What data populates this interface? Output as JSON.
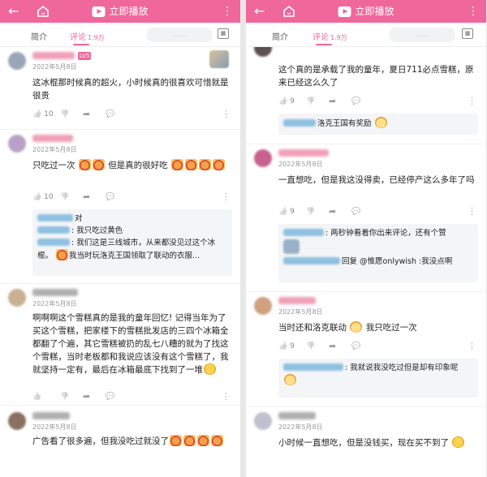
{
  "common": {
    "back_icon": "arrow-left-icon",
    "play_label": "立即播放",
    "tab_intro": "简介",
    "tab_comments": "评论",
    "comment_count": "1.9万",
    "calendar_icon": "calendar-icon",
    "date": "2022年5月8日",
    "colors": {
      "accent": "#f0679b",
      "bg": "#ffffff",
      "reply_bg": "#f4f5f7"
    }
  },
  "left": {
    "comments": [
      {
        "text": "这冰棍那时候真的超火，小时候真的很喜欢可惜就是很贵",
        "likes": "10",
        "badge": "LV5"
      },
      {
        "text_a": "只吃过一次",
        "text_b": "但是真的很好吃",
        "likes": "10",
        "replies": [
          {
            "text": "对"
          },
          {
            "text": ": 我只吃过黄色"
          },
          {
            "text_a": ": 我们这是三线城市，从来都没见过这个冰棍。",
            "text_b": "我当时玩洛克王国领取了联动的衣服..."
          }
        ]
      },
      {
        "text": "啊啊啊这个雪糕真的是我的童年回忆! 记得当年为了买这个雪糕，把家楼下的雪糕批发店的三四个冰箱全都翻了个遍，其它雪糕被扔的乱七八糟的就为了找这个雪糕，当时老板都和我说应该没有这个雪糕了，我就坚持一定有，最后在冰箱最底下找到了一堆",
        "likes": ""
      },
      {
        "text": "广告看了很多遍，但我没吃过就没了"
      }
    ]
  },
  "right": {
    "comments": [
      {
        "text": "这个真的是承载了我的童年，夏日711必点雪糕，原来已经这么久了",
        "likes": "9",
        "replies": [
          {
            "text": "洛克王国有奖励"
          }
        ]
      },
      {
        "text": "一直想吃，但是我这没得卖，已经停产这么多年了吗",
        "likes": "9",
        "replies": [
          {
            "text": ": 两秒钟看着你出来评论，还有个赞"
          },
          {
            "text": "回复 @惟愿onlywish :我没点啊"
          }
        ]
      },
      {
        "text_a": "当时还和洛克联动",
        "text_b": "我只吃过一次",
        "likes": "9",
        "replies": [
          {
            "text": ": 我就说我没吃过但是却有印象呢"
          }
        ]
      },
      {
        "text": "小时候一直想吃，但是没钱买，现在买不到了"
      }
    ]
  }
}
